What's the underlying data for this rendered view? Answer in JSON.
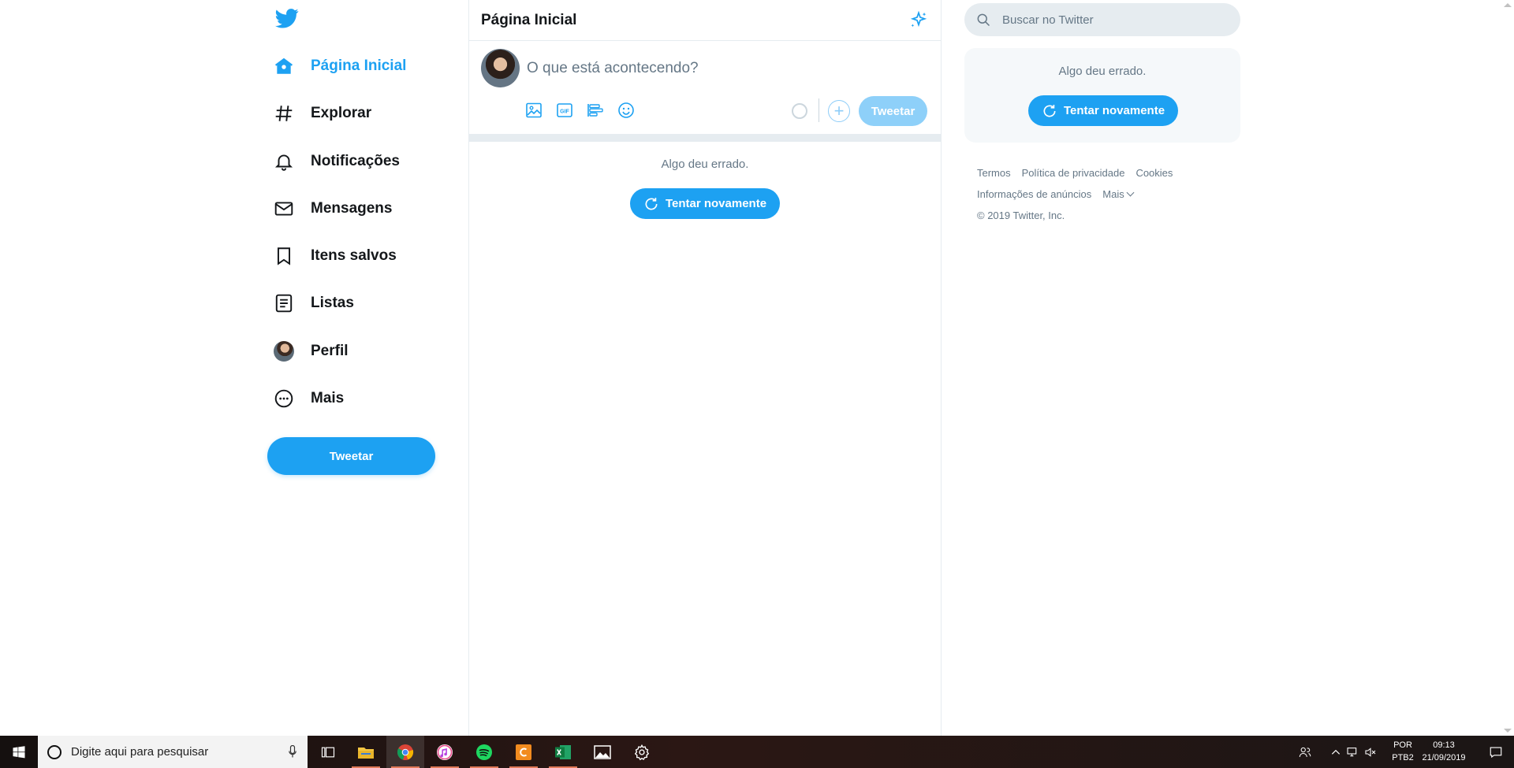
{
  "left_nav": {
    "items": [
      {
        "label": "Página Inicial",
        "icon": "home-icon",
        "active": true
      },
      {
        "label": "Explorar",
        "icon": "hashtag-icon"
      },
      {
        "label": "Notificações",
        "icon": "bell-icon"
      },
      {
        "label": "Mensagens",
        "icon": "envelope-icon"
      },
      {
        "label": "Itens salvos",
        "icon": "bookmark-icon"
      },
      {
        "label": "Listas",
        "icon": "list-icon"
      },
      {
        "label": "Perfil",
        "icon": "avatar"
      },
      {
        "label": "Mais",
        "icon": "more-icon"
      }
    ],
    "tweet_button": "Tweetar"
  },
  "center": {
    "title": "Página Inicial",
    "composer_placeholder": "O que está acontecendo?",
    "tweet_button": "Tweetar",
    "error_text": "Algo deu errado.",
    "retry_button": "Tentar novamente"
  },
  "right": {
    "search_placeholder": "Buscar no Twitter",
    "error_text": "Algo deu errado.",
    "retry_button": "Tentar novamente",
    "footer": {
      "terms": "Termos",
      "privacy": "Política de privacidade",
      "cookies": "Cookies",
      "ads_info": "Informações de anúncios",
      "more": "Mais",
      "copyright": "© 2019 Twitter, Inc."
    }
  },
  "taskbar": {
    "search_placeholder": "Digite aqui para pesquisar",
    "lang_line1": "POR",
    "lang_line2": "PTB2",
    "time": "09:13",
    "date": "21/09/2019"
  },
  "colors": {
    "accent": "#1da1f2",
    "accent_disabled": "#8ed0f9"
  }
}
